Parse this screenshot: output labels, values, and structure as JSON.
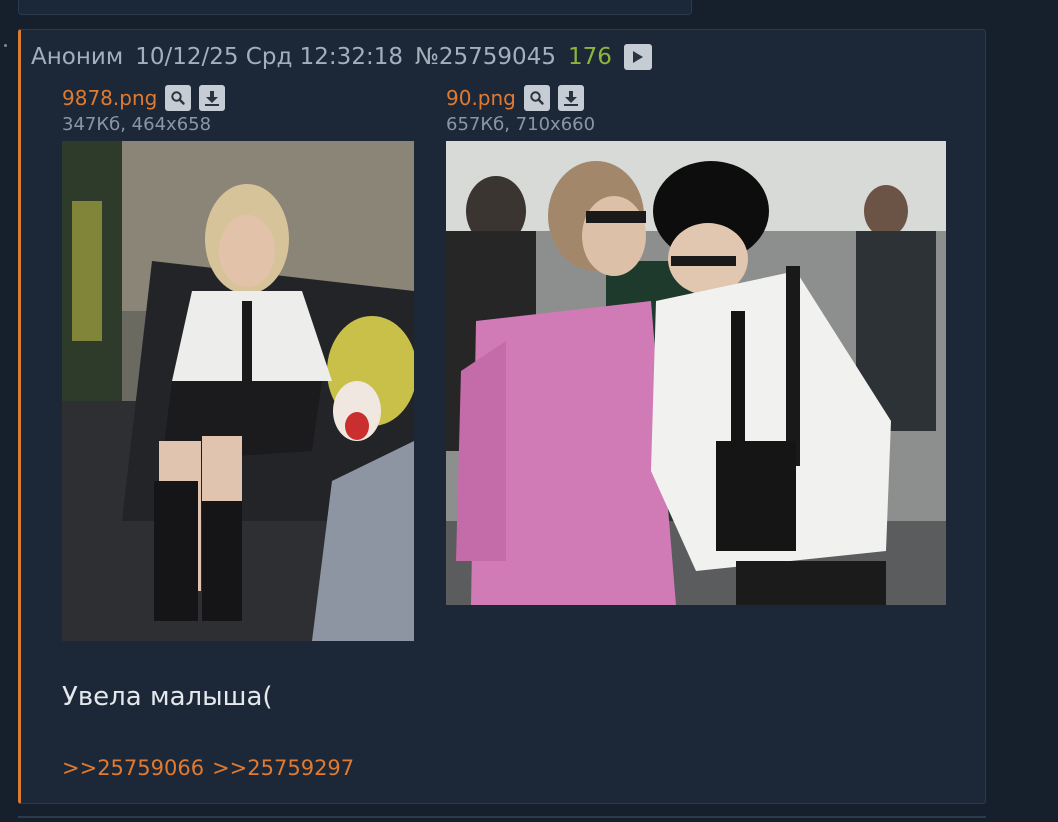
{
  "post": {
    "author": "Аноним",
    "date": "10/12/25 Срд 12:32:18",
    "number": "№25759045",
    "rating": "176",
    "text": "Увела малыша(",
    "replies": [
      ">>25759066",
      ">>25759297"
    ]
  },
  "files": [
    {
      "name": "9878.png",
      "meta": "347Кб, 464x658",
      "search_icon": "search-icon",
      "download_icon": "download-icon"
    },
    {
      "name": "90.png",
      "meta": "657Кб, 710x660",
      "search_icon": "search-icon",
      "download_icon": "download-icon"
    }
  ],
  "colors": {
    "background": "#16202c",
    "post_bg": "#1c2838",
    "accent": "#e07a30",
    "rating": "#8cb53a",
    "header_text": "#a5afbb",
    "meta_text": "#8c96a2",
    "body_text": "#e4e8ec"
  }
}
